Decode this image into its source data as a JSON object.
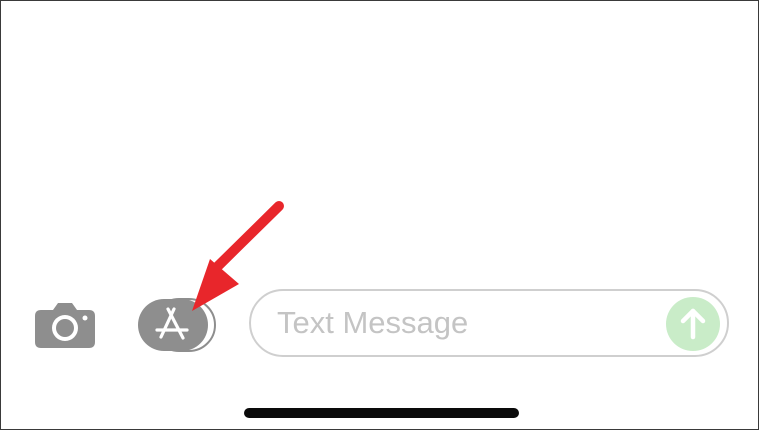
{
  "message_bar": {
    "placeholder": "Text Message",
    "value": ""
  },
  "icons": {
    "camera": "camera-icon",
    "apps": "app-store-icon",
    "send": "arrow-up-icon",
    "annotation": "red-arrow-annotation"
  },
  "colors": {
    "icon_gray": "#8e8e8e",
    "send_button_disabled": "#c9ecc8",
    "annotation_red": "#e8262b",
    "home_indicator": "#0a0a0a",
    "field_border": "#cfcfcf",
    "placeholder": "#c4c4c4"
  }
}
